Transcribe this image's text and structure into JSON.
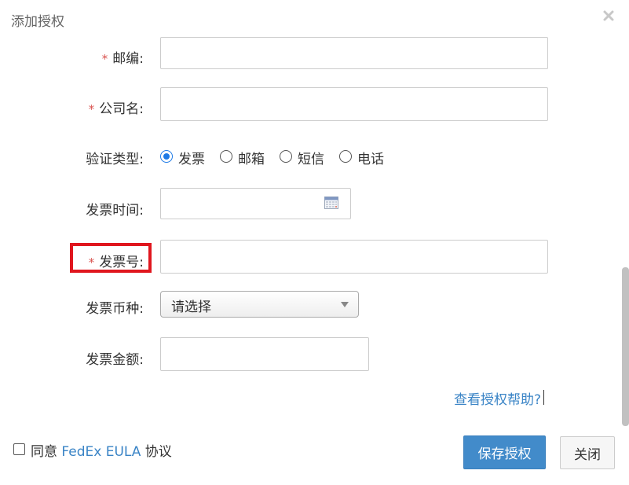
{
  "dialog": {
    "title": "添加授权",
    "close_icon": "close-icon"
  },
  "form": {
    "required_mark": "*",
    "zipcode": {
      "label": "邮编:",
      "value": ""
    },
    "company": {
      "label": "公司名:",
      "value": ""
    },
    "verify_type": {
      "label": "验证类型:",
      "options": [
        "发票",
        "邮箱",
        "短信",
        "电话"
      ],
      "selected": "发票"
    },
    "invoice_date": {
      "label": "发票时间:",
      "value": "",
      "icon": "calendar-icon"
    },
    "invoice_number": {
      "label": "发票号:",
      "value": ""
    },
    "invoice_currency": {
      "label": "发票币种:",
      "selected": "请选择"
    },
    "invoice_amount": {
      "label": "发票金额:",
      "value": ""
    }
  },
  "help_link": "查看授权帮助?",
  "agreement": {
    "prefix": "同意",
    "link": "FedEx EULA",
    "suffix": "协议",
    "checked": false
  },
  "buttons": {
    "save": "保存授权",
    "close": "关闭"
  },
  "colors": {
    "primary": "#428bca",
    "link": "#3a84c6",
    "required": "#d9534f",
    "highlight": "#e0161e"
  }
}
